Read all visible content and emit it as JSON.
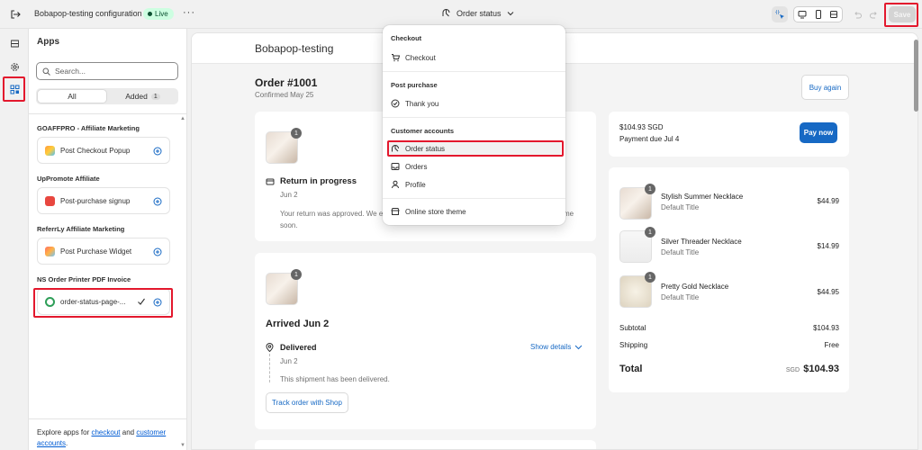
{
  "topbar": {
    "app_title": "Bobapop-testing configuration",
    "live_label": "Live",
    "more_label": "···",
    "page_selector": "Order status",
    "save_label": "Save"
  },
  "rail": {
    "icons": [
      "sections-icon",
      "settings-icon",
      "apps-icon"
    ]
  },
  "apps_panel": {
    "title": "Apps",
    "search_placeholder": "Search...",
    "tab_all": "All",
    "tab_added": "Added",
    "added_count": "1",
    "groups": [
      {
        "name": "GOAFFPRO - Affiliate Marketing",
        "app": "Post Checkout Popup"
      },
      {
        "name": "UpPromote Affiliate",
        "app": "Post-purchase signup"
      },
      {
        "name": "ReferrLy Affiliate Marketing",
        "app": "Post Purchase Widget"
      },
      {
        "name": "NS Order Printer PDF Invoice",
        "app": "order-status-page-..."
      }
    ],
    "footer_prefix": "Explore apps for ",
    "footer_link1": "checkout",
    "footer_and": " and ",
    "footer_link2": "customer accounts",
    "footer_suffix": "."
  },
  "dropdown": {
    "sections": [
      {
        "heading": "Checkout",
        "items": [
          "Checkout"
        ]
      },
      {
        "heading": "Post purchase",
        "items": [
          "Thank you"
        ]
      },
      {
        "heading": "Customer accounts",
        "items": [
          "Order status",
          "Orders",
          "Profile"
        ]
      }
    ],
    "footer_item": "Online store theme",
    "selected": "Order status"
  },
  "preview": {
    "shop_name": "Bobapop-testing",
    "order_title": "Order #1001",
    "order_sub": "Confirmed May 25",
    "buy_again": "Buy again",
    "return_card": {
      "qty": "1",
      "title": "Return in progress",
      "date": "Jun 2",
      "text_left": "Your return was approved. We e",
      "text_right": "me",
      "text_line2": "soon."
    },
    "arrived_card": {
      "qty": "1",
      "title": "Arrived Jun 2",
      "status": "Delivered",
      "status_date": "Jun 2",
      "show_details": "Show details",
      "message": "This shipment has been delivered.",
      "track_button": "Track order with Shop"
    },
    "payment": {
      "amount": "$104.93 SGD",
      "due": "Payment due Jul 4",
      "pay_now": "Pay now"
    },
    "items": [
      {
        "qty": "1",
        "name": "Stylish Summer Necklace",
        "variant": "Default Title",
        "price": "$44.99"
      },
      {
        "qty": "1",
        "name": "Silver Threader Necklace",
        "variant": "Default Title",
        "price": "$14.99"
      },
      {
        "qty": "1",
        "name": "Pretty Gold Necklace",
        "variant": "Default Title",
        "price": "$44.95"
      }
    ],
    "summary": {
      "subtotal_label": "Subtotal",
      "subtotal": "$104.93",
      "shipping_label": "Shipping",
      "shipping": "Free",
      "total_label": "Total",
      "currency": "SGD",
      "total": "$104.93"
    }
  },
  "colors": {
    "accent": "#1769c4",
    "highlight": "#e3182d",
    "live_bg": "#cdfee1"
  }
}
